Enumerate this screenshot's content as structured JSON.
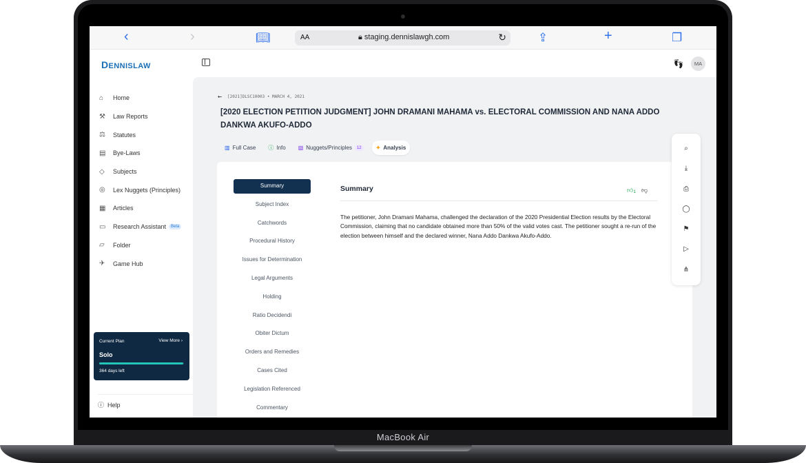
{
  "device": {
    "label": "MacBook Air"
  },
  "browser": {
    "url": "staging.dennislawgh.com",
    "text_size_label": "AA",
    "icons": [
      "back-icon",
      "forward-icon",
      "book-icon",
      "reload-icon",
      "share-icon",
      "plus-icon",
      "tabs-icon"
    ]
  },
  "app": {
    "logo": {
      "initial": "D",
      "rest": "ENNISLAW"
    },
    "avatar_initials": "MA",
    "nav": [
      {
        "label": "Home",
        "icon": "home-icon"
      },
      {
        "label": "Law Reports",
        "icon": "gavel-icon"
      },
      {
        "label": "Statutes",
        "icon": "scale-icon"
      },
      {
        "label": "Bye-Laws",
        "icon": "document-icon"
      },
      {
        "label": "Subjects",
        "icon": "cap-icon"
      },
      {
        "label": "Lex Nuggets (Principles)",
        "icon": "coin-icon"
      },
      {
        "label": "Articles",
        "icon": "article-icon"
      },
      {
        "label": "Research Assistant",
        "icon": "chat-icon",
        "badge": "Beta"
      },
      {
        "label": "Folder",
        "icon": "folder-icon"
      },
      {
        "label": "Game Hub",
        "icon": "rocket-icon"
      }
    ],
    "plan": {
      "current_label": "Current Plan",
      "view_more": "View More",
      "name": "Solo",
      "progress": 0.99,
      "days_left": "364 days left"
    },
    "help_label": "Help"
  },
  "case": {
    "breadcrumb": "[2021]DLSC10003 • MARCH 4, 2021",
    "title": "[2020 ELECTION PETITION JUDGMENT] JOHN DRAMANI MAHAMA vs. ELECTORAL COMMISSION AND NANA ADDO DANKWA AKUFO-ADDO",
    "tabs": [
      {
        "label": "Full Case",
        "icon": "book-icon",
        "color": "#2563eb"
      },
      {
        "label": "Info",
        "icon": "info-icon",
        "color": "#16a34a"
      },
      {
        "label": "Nuggets/Principles",
        "icon": "scroll-icon",
        "count": "12",
        "color": "#7c3aed"
      },
      {
        "label": "Analysis",
        "icon": "sparkle-icon",
        "active": true,
        "color": "#f59e0b"
      }
    ],
    "sections": [
      "Summary",
      "Subject Index",
      "Catchwords",
      "Procedural History",
      "Issues for Determination",
      "Legal Arguments",
      "Holding",
      "Ratio Decidendi",
      "Obiter Dictum",
      "Orders and Remedies",
      "Cases Cited",
      "Legislation Referenced",
      "Commentary"
    ],
    "summary": {
      "heading": "Summary",
      "likes": "1",
      "text": "The petitioner, John Dramani Mahama, challenged the declaration of the 2020 Presidential Election results by the Electoral Commission, claiming that no candidate obtained more than 50% of the valid votes cast. The petitioner sought a re-run of the election between himself and the declared winner, Nana Addo Dankwa Akufo-Addo."
    },
    "tools": [
      "search-icon",
      "download-icon",
      "print-icon",
      "comment-icon",
      "bookmark-icon",
      "folder-play-icon",
      "share-nodes-icon"
    ]
  }
}
